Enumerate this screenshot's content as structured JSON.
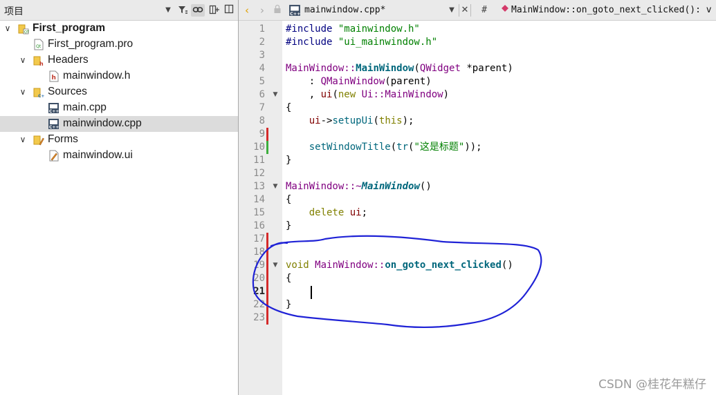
{
  "project_panel": {
    "title": "项目"
  },
  "tree": {
    "root": {
      "label": "First_program"
    },
    "pro_file": {
      "label": "First_program.pro"
    },
    "headers": {
      "label": "Headers"
    },
    "header_file": {
      "label": "mainwindow.h"
    },
    "sources": {
      "label": "Sources"
    },
    "source_main": {
      "label": "main.cpp"
    },
    "source_mainwindow": {
      "label": "mainwindow.cpp"
    },
    "forms": {
      "label": "Forms"
    },
    "form_file": {
      "label": "mainwindow.ui"
    }
  },
  "editor": {
    "file_tab": "mainwindow.cpp*",
    "hash_label": "#",
    "symbol": "MainWindow::on_goto_next_clicked(): v",
    "line_numbers": [
      "1",
      "2",
      "3",
      "4",
      "5",
      "6",
      "7",
      "8",
      "9",
      "10",
      "11",
      "12",
      "13",
      "14",
      "15",
      "16",
      "17",
      "18",
      "19",
      "20",
      "21",
      "22",
      "23"
    ]
  },
  "code": {
    "l1_a": "#include ",
    "l1_b": "\"mainwindow.h\"",
    "l2_a": "#include ",
    "l2_b": "\"ui_mainwindow.h\"",
    "l4_a": "MainWindow",
    "l4_b": "::",
    "l4_c": "MainWindow",
    "l4_d": "(",
    "l4_e": "QWidget",
    "l4_f": " *parent)",
    "l5_a": "    : ",
    "l5_b": "QMainWindow",
    "l5_c": "(parent)",
    "l6_a": "    , ",
    "l6_b": "ui",
    "l6_c": "(",
    "l6_d": "new",
    "l6_e": " ",
    "l6_f": "Ui",
    "l6_g": "::",
    "l6_h": "MainWindow",
    "l6_i": ")",
    "l7": "{",
    "l8_a": "    ",
    "l8_b": "ui",
    "l8_c": "->",
    "l8_d": "setupUi",
    "l8_e": "(",
    "l8_f": "this",
    "l8_g": ");",
    "l10_a": "    ",
    "l10_b": "setWindowTitle",
    "l10_c": "(",
    "l10_d": "tr",
    "l10_e": "(",
    "l10_f": "\"这是标题\"",
    "l10_g": "));",
    "l11": "}",
    "l13_a": "MainWindow",
    "l13_b": "::~",
    "l13_c": "MainWindow",
    "l13_d": "()",
    "l14": "{",
    "l15_a": "    ",
    "l15_b": "delete",
    "l15_c": " ",
    "l15_d": "ui",
    "l15_e": ";",
    "l16": "}",
    "l19_a": "void",
    "l19_b": " ",
    "l19_c": "MainWindow",
    "l19_d": "::",
    "l19_e": "on_goto_next_clicked",
    "l19_f": "()",
    "l20": "{",
    "l22": "}"
  },
  "watermark": "CSDN @桂花年糕仔",
  "colors": {
    "annotation_stroke": "#1f22d6",
    "change_marker_modified": "#d42a2a",
    "change_marker_saved": "#3cae3c"
  }
}
